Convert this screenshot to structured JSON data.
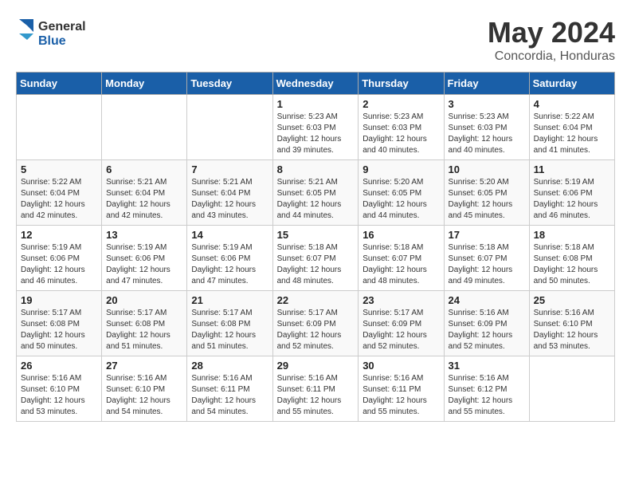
{
  "header": {
    "logo_general": "General",
    "logo_blue": "Blue",
    "month_year": "May 2024",
    "location": "Concordia, Honduras"
  },
  "days_of_week": [
    "Sunday",
    "Monday",
    "Tuesday",
    "Wednesday",
    "Thursday",
    "Friday",
    "Saturday"
  ],
  "weeks": [
    [
      {
        "day": "",
        "info": ""
      },
      {
        "day": "",
        "info": ""
      },
      {
        "day": "",
        "info": ""
      },
      {
        "day": "1",
        "info": "Sunrise: 5:23 AM\nSunset: 6:03 PM\nDaylight: 12 hours\nand 39 minutes."
      },
      {
        "day": "2",
        "info": "Sunrise: 5:23 AM\nSunset: 6:03 PM\nDaylight: 12 hours\nand 40 minutes."
      },
      {
        "day": "3",
        "info": "Sunrise: 5:23 AM\nSunset: 6:03 PM\nDaylight: 12 hours\nand 40 minutes."
      },
      {
        "day": "4",
        "info": "Sunrise: 5:22 AM\nSunset: 6:04 PM\nDaylight: 12 hours\nand 41 minutes."
      }
    ],
    [
      {
        "day": "5",
        "info": "Sunrise: 5:22 AM\nSunset: 6:04 PM\nDaylight: 12 hours\nand 42 minutes."
      },
      {
        "day": "6",
        "info": "Sunrise: 5:21 AM\nSunset: 6:04 PM\nDaylight: 12 hours\nand 42 minutes."
      },
      {
        "day": "7",
        "info": "Sunrise: 5:21 AM\nSunset: 6:04 PM\nDaylight: 12 hours\nand 43 minutes."
      },
      {
        "day": "8",
        "info": "Sunrise: 5:21 AM\nSunset: 6:05 PM\nDaylight: 12 hours\nand 44 minutes."
      },
      {
        "day": "9",
        "info": "Sunrise: 5:20 AM\nSunset: 6:05 PM\nDaylight: 12 hours\nand 44 minutes."
      },
      {
        "day": "10",
        "info": "Sunrise: 5:20 AM\nSunset: 6:05 PM\nDaylight: 12 hours\nand 45 minutes."
      },
      {
        "day": "11",
        "info": "Sunrise: 5:19 AM\nSunset: 6:06 PM\nDaylight: 12 hours\nand 46 minutes."
      }
    ],
    [
      {
        "day": "12",
        "info": "Sunrise: 5:19 AM\nSunset: 6:06 PM\nDaylight: 12 hours\nand 46 minutes."
      },
      {
        "day": "13",
        "info": "Sunrise: 5:19 AM\nSunset: 6:06 PM\nDaylight: 12 hours\nand 47 minutes."
      },
      {
        "day": "14",
        "info": "Sunrise: 5:19 AM\nSunset: 6:06 PM\nDaylight: 12 hours\nand 47 minutes."
      },
      {
        "day": "15",
        "info": "Sunrise: 5:18 AM\nSunset: 6:07 PM\nDaylight: 12 hours\nand 48 minutes."
      },
      {
        "day": "16",
        "info": "Sunrise: 5:18 AM\nSunset: 6:07 PM\nDaylight: 12 hours\nand 48 minutes."
      },
      {
        "day": "17",
        "info": "Sunrise: 5:18 AM\nSunset: 6:07 PM\nDaylight: 12 hours\nand 49 minutes."
      },
      {
        "day": "18",
        "info": "Sunrise: 5:18 AM\nSunset: 6:08 PM\nDaylight: 12 hours\nand 50 minutes."
      }
    ],
    [
      {
        "day": "19",
        "info": "Sunrise: 5:17 AM\nSunset: 6:08 PM\nDaylight: 12 hours\nand 50 minutes."
      },
      {
        "day": "20",
        "info": "Sunrise: 5:17 AM\nSunset: 6:08 PM\nDaylight: 12 hours\nand 51 minutes."
      },
      {
        "day": "21",
        "info": "Sunrise: 5:17 AM\nSunset: 6:08 PM\nDaylight: 12 hours\nand 51 minutes."
      },
      {
        "day": "22",
        "info": "Sunrise: 5:17 AM\nSunset: 6:09 PM\nDaylight: 12 hours\nand 52 minutes."
      },
      {
        "day": "23",
        "info": "Sunrise: 5:17 AM\nSunset: 6:09 PM\nDaylight: 12 hours\nand 52 minutes."
      },
      {
        "day": "24",
        "info": "Sunrise: 5:16 AM\nSunset: 6:09 PM\nDaylight: 12 hours\nand 52 minutes."
      },
      {
        "day": "25",
        "info": "Sunrise: 5:16 AM\nSunset: 6:10 PM\nDaylight: 12 hours\nand 53 minutes."
      }
    ],
    [
      {
        "day": "26",
        "info": "Sunrise: 5:16 AM\nSunset: 6:10 PM\nDaylight: 12 hours\nand 53 minutes."
      },
      {
        "day": "27",
        "info": "Sunrise: 5:16 AM\nSunset: 6:10 PM\nDaylight: 12 hours\nand 54 minutes."
      },
      {
        "day": "28",
        "info": "Sunrise: 5:16 AM\nSunset: 6:11 PM\nDaylight: 12 hours\nand 54 minutes."
      },
      {
        "day": "29",
        "info": "Sunrise: 5:16 AM\nSunset: 6:11 PM\nDaylight: 12 hours\nand 55 minutes."
      },
      {
        "day": "30",
        "info": "Sunrise: 5:16 AM\nSunset: 6:11 PM\nDaylight: 12 hours\nand 55 minutes."
      },
      {
        "day": "31",
        "info": "Sunrise: 5:16 AM\nSunset: 6:12 PM\nDaylight: 12 hours\nand 55 minutes."
      },
      {
        "day": "",
        "info": ""
      }
    ]
  ]
}
